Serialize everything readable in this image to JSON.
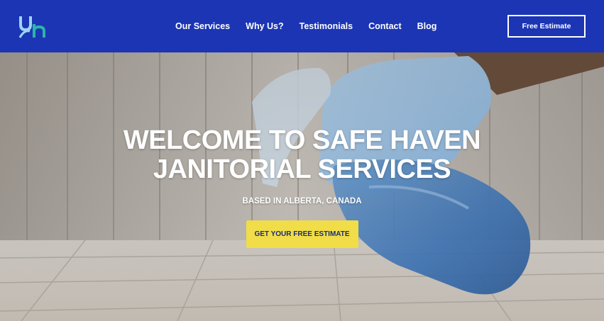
{
  "brand": {
    "logo_icon": "uh-monogram-icon",
    "colors": {
      "header": "#1b35b5",
      "logo_light": "#9fd3f5",
      "logo_teal": "#2bb5a6",
      "cta": "#f0dd48",
      "cta_text": "#1b2a7a"
    }
  },
  "nav": {
    "items": [
      {
        "label": "Our Services"
      },
      {
        "label": "Why Us?"
      },
      {
        "label": "Testimonials"
      },
      {
        "label": "Contact"
      },
      {
        "label": "Blog"
      }
    ],
    "estimate_label": "Free Estimate"
  },
  "hero": {
    "title_line1": "WELCOME TO SAFE HAVEN",
    "title_line2": "JANITORIAL SERVICES",
    "subtitle": "BASED IN ALBERTA, CANADA",
    "cta_label": "GET YOUR FREE ESTIMATE",
    "image_subject": "gloved-hand-spray-bottle-image"
  }
}
